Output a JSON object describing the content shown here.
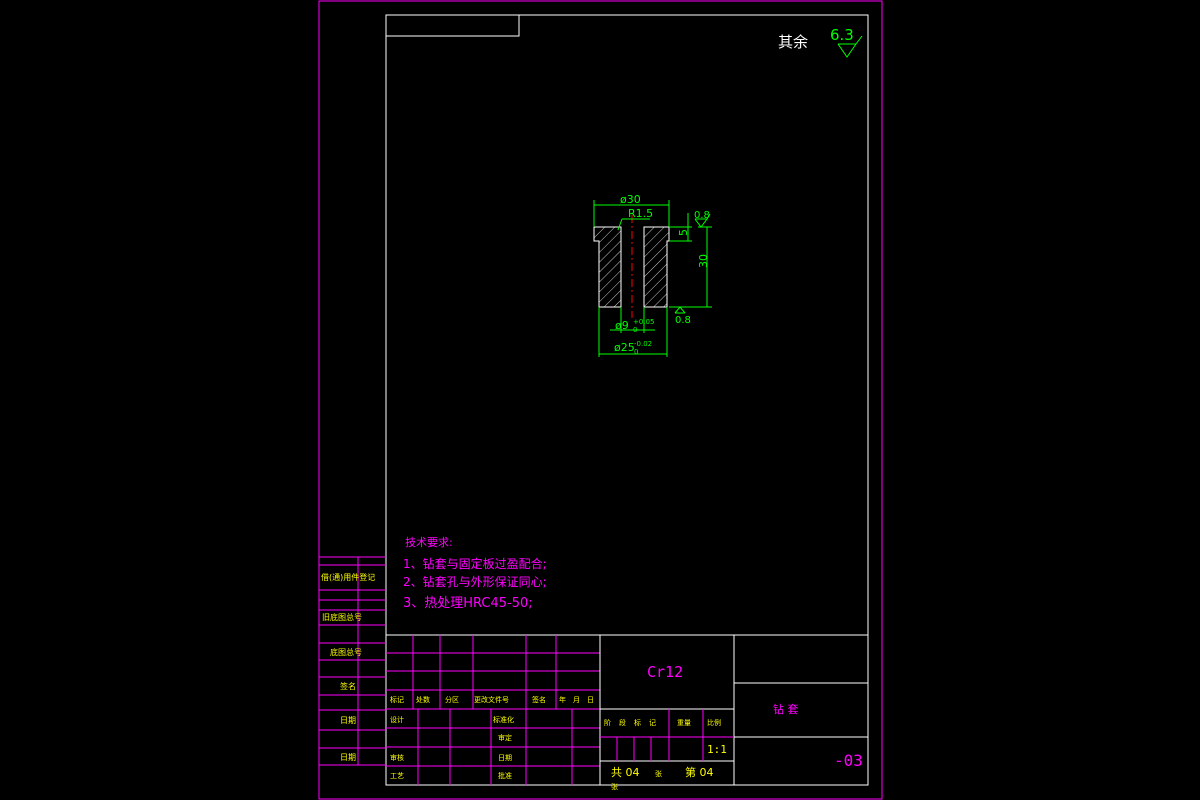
{
  "colors": {
    "background": "#000000",
    "frame": "#ff00ff",
    "border": "#ffffff",
    "part": "#ffffff",
    "dimension": "#00ff00",
    "centerline": "#ff0000",
    "hatch": "#ffffff",
    "notes": "#ff00ff",
    "title_text": "#ff00ff",
    "table_text": "#ffff00"
  },
  "roughness_default": {
    "label": "其余",
    "value": "6.3"
  },
  "part_dimensions": {
    "flange_diameter": "ø30",
    "fillet_radius": "R1.5",
    "roughness_top": "0.8",
    "flange_thickness": "5",
    "overall_height": "30",
    "bore_diameter": "ø9",
    "bore_tolerance_upper": "+0.05",
    "bore_tolerance_lower": "0",
    "body_diameter": "ø25",
    "body_tolerance_upper": "-0.02",
    "body_tolerance_lower": "0",
    "roughness_bottom": "0.8"
  },
  "technical_requirements": {
    "heading": "技术要求:",
    "items": [
      "1、钻套与固定板过盈配合;",
      "2、钻套孔与外形保证同心;",
      "3、热处理HRC45-50;"
    ]
  },
  "side_table": {
    "labels": [
      "借(通)用件登记",
      "旧底图总号",
      "底图总号",
      "签名",
      "日期",
      "日期"
    ]
  },
  "title_block": {
    "material": "Cr12",
    "part_name": "钻    套",
    "drawing_number": "-03",
    "revision_headers": [
      "标记",
      "处数",
      "分区",
      "更改文件号",
      "签名",
      "年",
      "月",
      "日"
    ],
    "signature_labels": [
      "设计",
      "标准化",
      "审核",
      "工艺",
      "批准"
    ],
    "sig_extra": [
      "审定",
      "日期"
    ],
    "stage_labels": [
      "阶",
      "段",
      "标",
      "记"
    ],
    "weight_label": "重量",
    "scale_label": "比例",
    "scale_value": "1:1",
    "sheets_total": "共 04",
    "sheets_total_suffix": "张",
    "sheet_current": "第 04",
    "sheet_current_prefix": "张"
  }
}
